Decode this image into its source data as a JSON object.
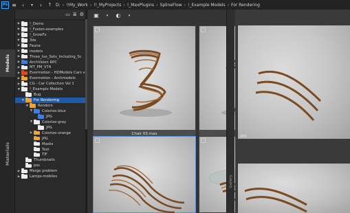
{
  "path": {
    "app_icon": "Ps",
    "drive": "D:",
    "crumbs": [
      "!!My_Work",
      "!!_MyProjects",
      "!_MaxPlugins",
      "SplineFlow",
      "!_Example Models",
      "For Rendering"
    ]
  },
  "left_tabs": {
    "models": "Models",
    "materials": "Materials"
  },
  "tree": [
    {
      "label": "!_Demo",
      "level": 0,
      "arrow": "right",
      "color": "white"
    },
    {
      "label": "!_Fusion-examples",
      "level": 0,
      "arrow": "right",
      "color": "white"
    },
    {
      "label": "!_GrowFx",
      "level": 0,
      "arrow": "right",
      "color": "white"
    },
    {
      "label": "3ds",
      "level": 0,
      "arrow": "right",
      "color": "white"
    },
    {
      "label": "Fauna",
      "level": 0,
      "arrow": "right",
      "color": "white"
    },
    {
      "label": "models",
      "level": 0,
      "arrow": "right",
      "color": "white"
    },
    {
      "label": "Three_Ivo_Sets_Including_Sc",
      "level": 0,
      "arrow": "right",
      "color": "white"
    },
    {
      "label": "ArchVision RPC",
      "level": 0,
      "arrow": "right",
      "color": "blue"
    },
    {
      "label": "MT_PM_V74",
      "level": 0,
      "arrow": "right",
      "color": "white"
    },
    {
      "label": "Evermotion - HDModels Cars v",
      "level": 0,
      "arrow": "right",
      "color": "red"
    },
    {
      "label": "Evermotion - Archmodels",
      "level": 0,
      "arrow": "right",
      "color": "orange"
    },
    {
      "label": "CG - Car Collection Vol 1",
      "level": 0,
      "arrow": "right",
      "color": "white"
    },
    {
      "label": "!_Example Models",
      "level": 0,
      "arrow": "down",
      "color": "white"
    },
    {
      "label": "Bug",
      "level": 1,
      "arrow": "",
      "color": "white"
    },
    {
      "label": "For Rendering",
      "level": 1,
      "arrow": "down",
      "color": "orange",
      "selected": true
    },
    {
      "label": "Renders",
      "level": 2,
      "arrow": "down",
      "color": "orange"
    },
    {
      "label": "Colorize-blue",
      "level": 3,
      "arrow": "down",
      "color": "blue"
    },
    {
      "label": "JPG",
      "level": 4,
      "arrow": "",
      "color": "blue"
    },
    {
      "label": "Colorize-gray",
      "level": 3,
      "arrow": "down",
      "color": "white"
    },
    {
      "label": "JPG",
      "level": 4,
      "arrow": "",
      "color": "white"
    },
    {
      "label": "Colorize-orange",
      "level": 3,
      "arrow": "right",
      "color": "orange"
    },
    {
      "label": "JPG",
      "level": 3,
      "arrow": "",
      "color": "orange"
    },
    {
      "label": "Masks",
      "level": 3,
      "arrow": "",
      "color": "white"
    },
    {
      "label": "Test",
      "level": 3,
      "arrow": "",
      "color": "white"
    },
    {
      "label": "TIF",
      "level": 3,
      "arrow": "",
      "color": "white"
    },
    {
      "label": "Thumbnails",
      "level": 1,
      "arrow": "",
      "color": "white"
    },
    {
      "label": "pss",
      "level": 1,
      "arrow": "",
      "color": "white"
    },
    {
      "label": "Merge problem",
      "level": 0,
      "arrow": "right",
      "color": "white"
    },
    {
      "label": "Lamps-mobiles",
      "level": 0,
      "arrow": "right",
      "color": "white"
    }
  ],
  "grid": {
    "items": [
      {
        "label": "Chair 03.max"
      },
      {
        "label": "Chair 04.max"
      },
      {
        "label": ""
      },
      {
        "label": ""
      }
    ]
  },
  "side_tab": "Gallery",
  "preview": {
    "label": ".jpg"
  }
}
